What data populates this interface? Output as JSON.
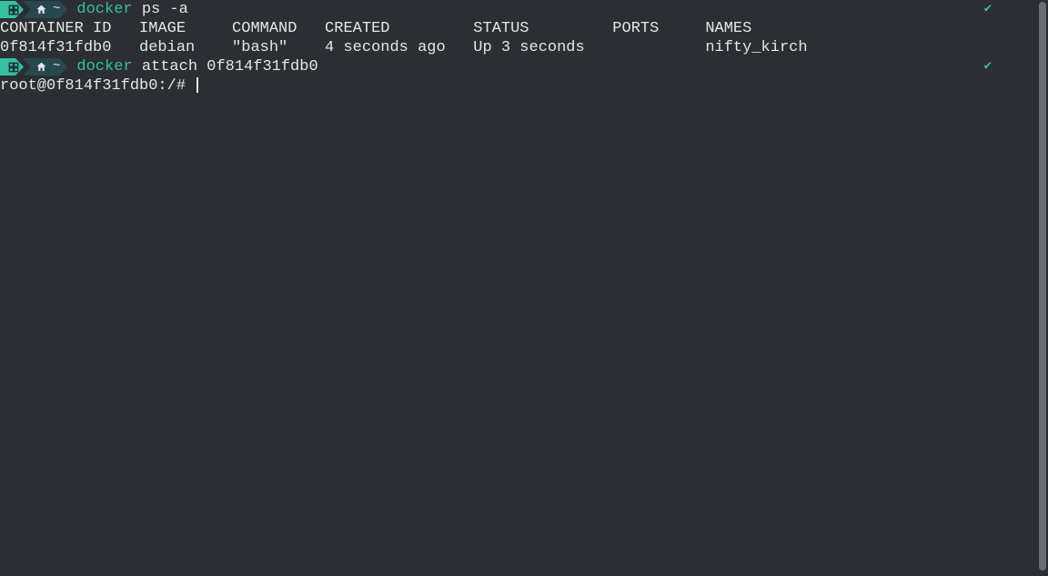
{
  "prompt1": {
    "home_symbol": "~",
    "command_green": "docker",
    "command_rest": " ps -a",
    "check": "✔"
  },
  "headers": "CONTAINER ID   IMAGE     COMMAND   CREATED         STATUS         PORTS     NAMES",
  "row1": "0f814f31fdb0   debian    \"bash\"    4 seconds ago   Up 3 seconds             nifty_kirch",
  "prompt2": {
    "home_symbol": "~",
    "command_green": "docker",
    "command_rest": " attach 0f814f31fdb0",
    "check": "✔"
  },
  "shell_prompt": "root@0f814f31fdb0:/# "
}
